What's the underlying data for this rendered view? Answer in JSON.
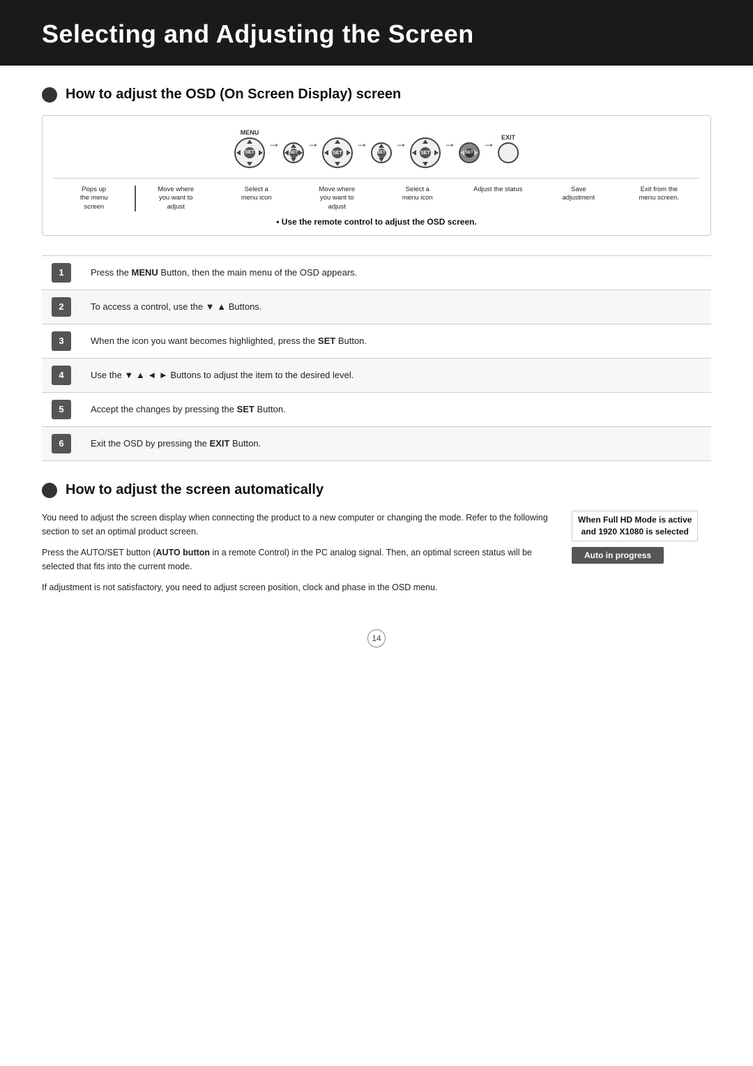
{
  "header": {
    "title": "Selecting and Adjusting the Screen"
  },
  "section1": {
    "heading": "How to adjust the OSD (On Screen Display) screen",
    "diagram": {
      "labels": [
        {
          "text": "Pops up\nthe menu\nscreen"
        },
        {
          "text": "Move where\nyou want to\nadjust"
        },
        {
          "text": "Select a\nmenu icon"
        },
        {
          "text": "Move where\nyou want to\nadjust"
        },
        {
          "text": "Select a\nmenu icon"
        },
        {
          "text": "Adjust the status"
        },
        {
          "text": "Save\nadjustment"
        },
        {
          "text": "Exit from the\nmenu screen."
        }
      ],
      "note": "• Use the remote control to adjust the OSD screen."
    },
    "steps": [
      {
        "num": "1",
        "text_pre": "Press the ",
        "bold": "MENU",
        "text_post": " Button, then the main menu of the OSD appears."
      },
      {
        "num": "2",
        "text_pre": "To access a control, use the ▼ ▲ Buttons.",
        "bold": "",
        "text_post": ""
      },
      {
        "num": "3",
        "text_pre": "When the icon you want becomes highlighted, press the ",
        "bold": "SET",
        "text_post": " Button."
      },
      {
        "num": "4",
        "text_pre": "Use the ▼ ▲ ◄ ► Buttons to adjust the item to the desired level.",
        "bold": "",
        "text_post": ""
      },
      {
        "num": "5",
        "text_pre": "Accept the changes by pressing the ",
        "bold": "SET",
        "text_post": " Button."
      },
      {
        "num": "6",
        "text_pre": "Exit the OSD by pressing the ",
        "bold": "EXIT",
        "text_post": " Button."
      }
    ]
  },
  "section2": {
    "heading": "How to adjust the screen automatically",
    "para1": "You need to adjust the screen display when connecting the product to a new computer or changing the mode. Refer to the following section to set an optimal product screen.",
    "para2_pre": "Press the AUTO/SET button (",
    "para2_bold": "AUTO button",
    "para2_post": " in a remote Control) in the PC analog signal. Then, an optimal screen status will be selected that fits into the current mode.",
    "para3": "If adjustment is not satisfactory, you need to adjust screen position, clock and phase in the OSD menu.",
    "full_hd_note": "When Full HD Mode is active\nand  1920 X1080 is selected",
    "auto_progress": "Auto in progress"
  },
  "footer": {
    "page_number": "14"
  }
}
